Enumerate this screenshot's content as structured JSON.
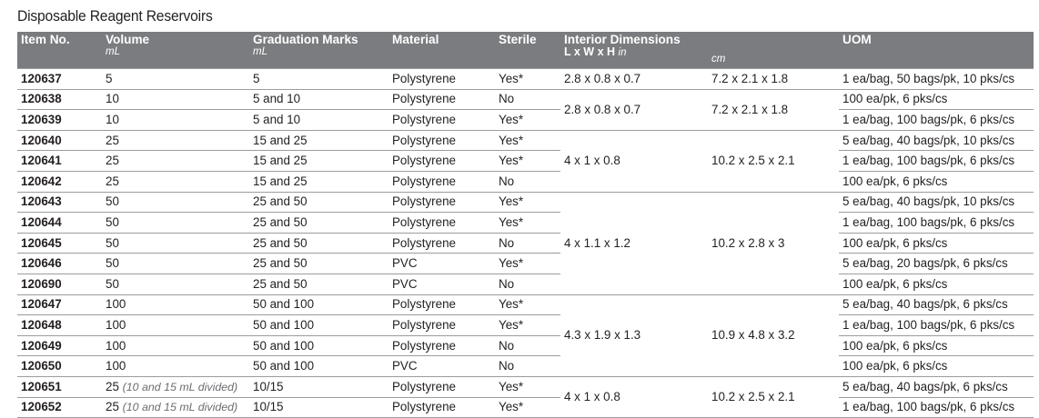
{
  "title": "Disposable Reagent Reservoirs",
  "headers": {
    "item": "Item No.",
    "volume": "Volume",
    "volume_unit": "mL",
    "graduation": "Graduation Marks",
    "graduation_unit": "mL",
    "material": "Material",
    "sterile": "Sterile",
    "dims": "Interior Dimensions",
    "dims_sub": "L x W x H",
    "dims_in": "in",
    "dims_cm": "cm",
    "uom": "UOM"
  },
  "rows": [
    {
      "item": "120637",
      "volume": "5",
      "volume_note": "",
      "graduation": "5",
      "material": "Polystyrene",
      "sterile": "Yes*",
      "uom": "1 ea/bag, 50 bags/pk, 10 pks/cs"
    },
    {
      "item": "120638",
      "volume": "10",
      "volume_note": "",
      "graduation": "5 and 10",
      "material": "Polystyrene",
      "sterile": "No",
      "uom": "100 ea/pk, 6 pks/cs"
    },
    {
      "item": "120639",
      "volume": "10",
      "volume_note": "",
      "graduation": "5 and 10",
      "material": "Polystyrene",
      "sterile": "Yes*",
      "uom": "1 ea/bag, 100 bags/pk, 6 pks/cs"
    },
    {
      "item": "120640",
      "volume": "25",
      "volume_note": "",
      "graduation": "15 and 25",
      "material": "Polystyrene",
      "sterile": "Yes*",
      "uom": "5 ea/bag, 40 bags/pk, 10 pks/cs"
    },
    {
      "item": "120641",
      "volume": "25",
      "volume_note": "",
      "graduation": "15 and 25",
      "material": "Polystyrene",
      "sterile": "Yes*",
      "uom": "1 ea/bag, 100 bags/pk, 6 pks/cs"
    },
    {
      "item": "120642",
      "volume": "25",
      "volume_note": "",
      "graduation": "15 and 25",
      "material": "Polystyrene",
      "sterile": "No",
      "uom": "100 ea/pk, 6 pks/cs"
    },
    {
      "item": "120643",
      "volume": "50",
      "volume_note": "",
      "graduation": "25 and 50",
      "material": "Polystyrene",
      "sterile": "Yes*",
      "uom": "5 ea/bag, 40 bags/pk, 10 pks/cs"
    },
    {
      "item": "120644",
      "volume": "50",
      "volume_note": "",
      "graduation": "25 and 50",
      "material": "Polystyrene",
      "sterile": "Yes*",
      "uom": "1 ea/bag, 100 bags/pk, 6 pks/cs"
    },
    {
      "item": "120645",
      "volume": "50",
      "volume_note": "",
      "graduation": "25 and 50",
      "material": "Polystyrene",
      "sterile": "No",
      "uom": "100 ea/pk, 6 pks/cs"
    },
    {
      "item": "120646",
      "volume": "50",
      "volume_note": "",
      "graduation": "25 and 50",
      "material": "PVC",
      "sterile": "Yes*",
      "uom": "5 ea/bag, 20 bags/pk, 6 pks/cs"
    },
    {
      "item": "120690",
      "volume": "50",
      "volume_note": "",
      "graduation": "25 and 50",
      "material": "PVC",
      "sterile": "No",
      "uom": "100 ea/pk, 6 pks/cs"
    },
    {
      "item": "120647",
      "volume": "100",
      "volume_note": "",
      "graduation": "50 and 100",
      "material": "Polystyrene",
      "sterile": "Yes*",
      "uom": "5 ea/bag, 40 bags/pk, 6 pks/cs"
    },
    {
      "item": "120648",
      "volume": "100",
      "volume_note": "",
      "graduation": "50 and 100",
      "material": "Polystyrene",
      "sterile": "Yes*",
      "uom": "1 ea/bag, 100 bags/pk, 6 pks/cs"
    },
    {
      "item": "120649",
      "volume": "100",
      "volume_note": "",
      "graduation": "50 and 100",
      "material": "Polystyrene",
      "sterile": "No",
      "uom": "100 ea/pk, 6 pks/cs"
    },
    {
      "item": "120650",
      "volume": "100",
      "volume_note": "",
      "graduation": "50 and 100",
      "material": "PVC",
      "sterile": "No",
      "uom": "100 ea/pk, 6 pks/cs"
    },
    {
      "item": "120651",
      "volume": "25",
      "volume_note": "(10 and 15 mL divided)",
      "graduation": "10/15",
      "material": "Polystyrene",
      "sterile": "Yes*",
      "uom": "5 ea/bag, 40 bags/pk, 6 pks/cs"
    },
    {
      "item": "120652",
      "volume": "25",
      "volume_note": "(10 and 15 mL divided)",
      "graduation": "10/15",
      "material": "Polystyrene",
      "sterile": "Yes*",
      "uom": "1 ea/bag, 100 bags/pk, 6 pks/cs"
    }
  ],
  "dimension_groups": [
    {
      "rows": 1,
      "in": "2.8 x 0.8 x 0.7",
      "cm": "7.2 x 2.1 x 1.8"
    },
    {
      "rows": 2,
      "in": "2.8 x 0.8 x 0.7",
      "cm": "7.2 x 2.1 x 1.8"
    },
    {
      "rows": 3,
      "in": "4 x 1 x 0.8",
      "cm": "10.2 x 2.5 x 2.1"
    },
    {
      "rows": 5,
      "in": "4 x 1.1 x 1.2",
      "cm": "10.2 x 2.8 x 3"
    },
    {
      "rows": 4,
      "in": "4.3 x 1.9 x 1.3",
      "cm": "10.9 x 4.8 x 3.2"
    },
    {
      "rows": 2,
      "in": "4 x 1 x 0.8",
      "cm": "10.2 x 2.5 x 2.1"
    }
  ]
}
